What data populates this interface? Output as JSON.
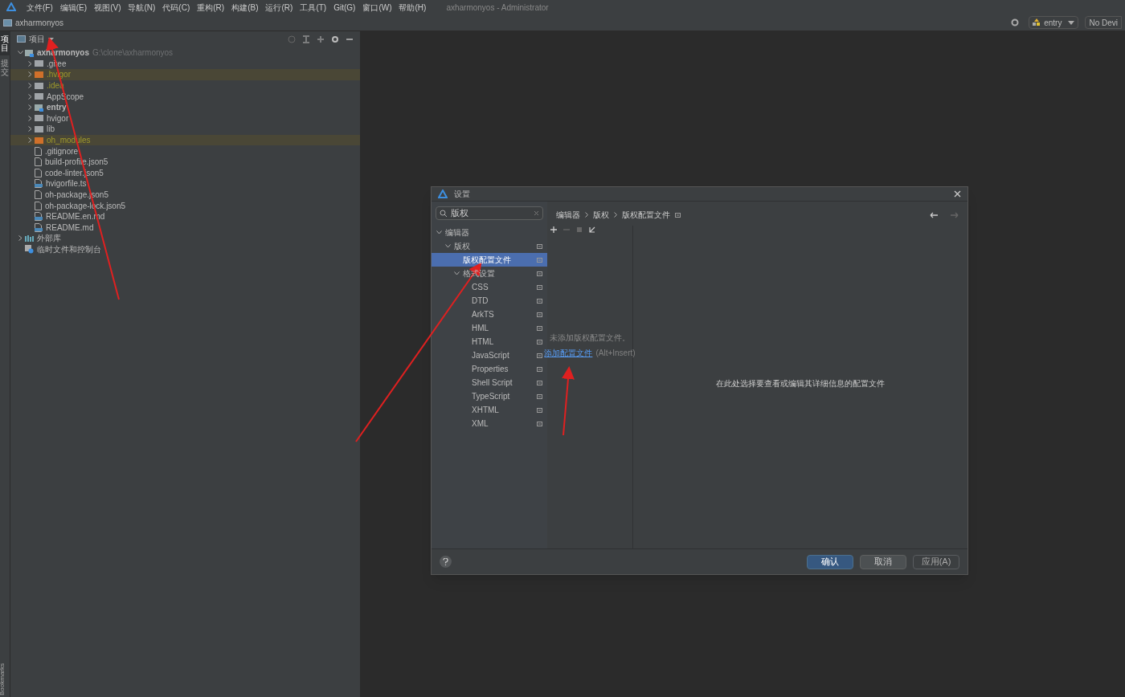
{
  "menu_bar": {
    "items": [
      "文件(F)",
      "编辑(E)",
      "视图(V)",
      "导航(N)",
      "代码(C)",
      "重构(R)",
      "构建(B)",
      "运行(R)",
      "工具(T)",
      "Git(G)",
      "窗口(W)",
      "帮助(H)"
    ],
    "title": "axharmonyos - Administrator"
  },
  "nav_bar": {
    "project": "axharmonyos",
    "run_config": "entry",
    "device": "No Devi"
  },
  "tool_strip": {
    "top": [
      {
        "label": "项目",
        "selected": true
      },
      {
        "label": "提交",
        "selected": false
      }
    ],
    "bottom": "Bookmarks"
  },
  "project_panel": {
    "title": "项目",
    "tree": [
      {
        "name": "axharmonyos",
        "path": "G:\\clone\\axharmonyos",
        "kind": "module",
        "expanded": true,
        "bold": true,
        "ignored": false,
        "highlighted": false,
        "children": [
          {
            "name": ".gitee",
            "kind": "folder",
            "expanded": false,
            "bold": false,
            "ignored": false,
            "highlighted": false
          },
          {
            "name": ".hvigor",
            "kind": "folder-excluded",
            "expanded": false,
            "bold": false,
            "ignored": true,
            "highlighted": true
          },
          {
            "name": ".idea",
            "kind": "folder",
            "expanded": false,
            "bold": false,
            "ignored": true,
            "highlighted": false
          },
          {
            "name": "AppScope",
            "kind": "folder",
            "expanded": false,
            "bold": false,
            "ignored": false,
            "highlighted": false
          },
          {
            "name": "entry",
            "kind": "module",
            "expanded": false,
            "bold": true,
            "ignored": false,
            "highlighted": false
          },
          {
            "name": "hvigor",
            "kind": "folder",
            "expanded": false,
            "bold": false,
            "ignored": false,
            "highlighted": false
          },
          {
            "name": "lib",
            "kind": "folder",
            "expanded": false,
            "bold": false,
            "ignored": false,
            "highlighted": false
          },
          {
            "name": "oh_modules",
            "kind": "folder-excluded",
            "expanded": false,
            "bold": false,
            "ignored": true,
            "highlighted": true
          },
          {
            "name": ".gitignore",
            "kind": "file",
            "bold": false,
            "ignored": false,
            "highlighted": false
          },
          {
            "name": "build-profile.json5",
            "kind": "file",
            "bold": false,
            "ignored": false,
            "highlighted": false
          },
          {
            "name": "code-linter.json5",
            "kind": "file",
            "bold": false,
            "ignored": false,
            "highlighted": false
          },
          {
            "name": "hvigorfile.ts",
            "kind": "file-code",
            "bold": false,
            "ignored": false,
            "highlighted": false
          },
          {
            "name": "oh-package.json5",
            "kind": "file",
            "bold": false,
            "ignored": false,
            "highlighted": false
          },
          {
            "name": "oh-package-lock.json5",
            "kind": "file",
            "bold": false,
            "ignored": false,
            "highlighted": false
          },
          {
            "name": "README.en.md",
            "kind": "file-code",
            "bold": false,
            "ignored": false,
            "highlighted": false
          },
          {
            "name": "README.md",
            "kind": "file-code",
            "bold": false,
            "ignored": false,
            "highlighted": false
          }
        ]
      },
      {
        "name": "外部库",
        "kind": "library",
        "expanded": false,
        "bold": false,
        "ignored": false,
        "highlighted": false
      },
      {
        "name": "临时文件和控制台",
        "kind": "scratch",
        "bold": false,
        "ignored": false,
        "highlighted": false
      }
    ]
  },
  "dialog": {
    "title": "设置",
    "search": {
      "value": "版权"
    },
    "tree": [
      {
        "label": "编辑器",
        "expanded": true,
        "selected": false,
        "children": [
          {
            "label": "版权",
            "expanded": true,
            "selected": false,
            "children": [
              {
                "label": "版权配置文件",
                "selected": true
              },
              {
                "label": "格式设置",
                "expanded": true,
                "selected": false,
                "children": [
                  {
                    "label": "CSS",
                    "selected": false
                  },
                  {
                    "label": "DTD",
                    "selected": false
                  },
                  {
                    "label": "ArkTS",
                    "selected": false
                  },
                  {
                    "label": "HML",
                    "selected": false
                  },
                  {
                    "label": "HTML",
                    "selected": false
                  },
                  {
                    "label": "JavaScript",
                    "selected": false
                  },
                  {
                    "label": "Properties",
                    "selected": false
                  },
                  {
                    "label": "Shell Script",
                    "selected": false
                  },
                  {
                    "label": "TypeScript",
                    "selected": false
                  },
                  {
                    "label": "XHTML",
                    "selected": false
                  },
                  {
                    "label": "XML",
                    "selected": false
                  }
                ]
              }
            ]
          }
        ]
      }
    ],
    "breadcrumb": [
      "编辑器",
      "版权",
      "版权配置文件"
    ],
    "empty_text": "未添加版权配置文件。",
    "add_link": "添加配置文件",
    "add_shortcut": "(Alt+Insert)",
    "detail_hint": "在此处选择要查看或编辑其详细信息的配置文件",
    "buttons": [
      {
        "label": "确认",
        "kind": "primary",
        "disabled": false
      },
      {
        "label": "取消",
        "kind": "normal",
        "disabled": false
      },
      {
        "label": "应用(A)",
        "kind": "normal",
        "disabled": true
      }
    ]
  }
}
